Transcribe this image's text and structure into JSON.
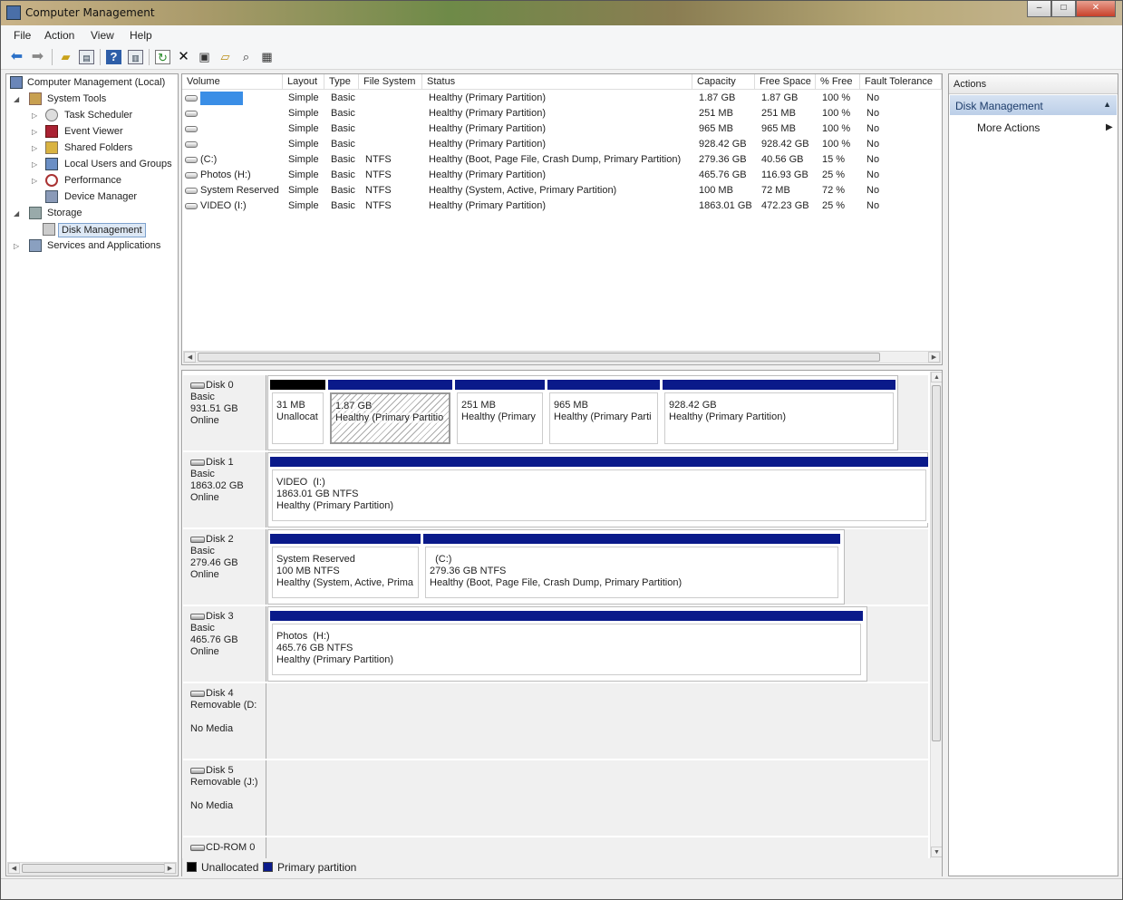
{
  "window": {
    "title": "Computer Management",
    "minimize": "–",
    "maximize": "□",
    "close": "✕"
  },
  "menu": [
    "File",
    "Action",
    "View",
    "Help"
  ],
  "toolbar": [
    "back-icon",
    "forward-icon",
    "up-folder-icon",
    "show-hide-tree-icon",
    "help-icon",
    "properties-icon",
    "refresh-icon",
    "delete-icon",
    "export-icon",
    "open-icon",
    "search-icon",
    "settings-icon"
  ],
  "tree": {
    "root": "Computer Management (Local)",
    "system_tools": "System Tools",
    "task_scheduler": "Task Scheduler",
    "event_viewer": "Event Viewer",
    "shared_folders": "Shared Folders",
    "local_users": "Local Users and Groups",
    "performance": "Performance",
    "device_manager": "Device Manager",
    "storage": "Storage",
    "disk_management": "Disk Management",
    "services": "Services and Applications"
  },
  "volumes": {
    "headers": [
      "Volume",
      "Layout",
      "Type",
      "File System",
      "Status",
      "Capacity",
      "Free Space",
      "% Free",
      "Fault Tolerance"
    ],
    "rows": [
      {
        "volume": "",
        "layout": "Simple",
        "type": "Basic",
        "fs": "",
        "status": "Healthy (Primary Partition)",
        "capacity": "1.87 GB",
        "free": "1.87 GB",
        "pct": "100 %",
        "fault": "No"
      },
      {
        "volume": "",
        "layout": "Simple",
        "type": "Basic",
        "fs": "",
        "status": "Healthy (Primary Partition)",
        "capacity": "251 MB",
        "free": "251 MB",
        "pct": "100 %",
        "fault": "No"
      },
      {
        "volume": "",
        "layout": "Simple",
        "type": "Basic",
        "fs": "",
        "status": "Healthy (Primary Partition)",
        "capacity": "965 MB",
        "free": "965 MB",
        "pct": "100 %",
        "fault": "No"
      },
      {
        "volume": "",
        "layout": "Simple",
        "type": "Basic",
        "fs": "",
        "status": "Healthy (Primary Partition)",
        "capacity": "928.42 GB",
        "free": "928.42 GB",
        "pct": "100 %",
        "fault": "No"
      },
      {
        "volume": "(C:)",
        "layout": "Simple",
        "type": "Basic",
        "fs": "NTFS",
        "status": "Healthy (Boot, Page File, Crash Dump, Primary Partition)",
        "capacity": "279.36 GB",
        "free": "40.56 GB",
        "pct": "15 %",
        "fault": "No"
      },
      {
        "volume": "Photos (H:)",
        "layout": "Simple",
        "type": "Basic",
        "fs": "NTFS",
        "status": "Healthy (Primary Partition)",
        "capacity": "465.76 GB",
        "free": "116.93 GB",
        "pct": "25 %",
        "fault": "No"
      },
      {
        "volume": "System Reserved",
        "layout": "Simple",
        "type": "Basic",
        "fs": "NTFS",
        "status": "Healthy (System, Active, Primary Partition)",
        "capacity": "100 MB",
        "free": "72 MB",
        "pct": "72 %",
        "fault": "No"
      },
      {
        "volume": "VIDEO (I:)",
        "layout": "Simple",
        "type": "Basic",
        "fs": "NTFS",
        "status": "Healthy (Primary Partition)",
        "capacity": "1863.01 GB",
        "free": "472.23 GB",
        "pct": "25 %",
        "fault": "No"
      }
    ]
  },
  "disks": [
    {
      "name": "Disk 0",
      "type": "Basic",
      "size": "931.51 GB",
      "state": "Online",
      "parts": [
        {
          "l1": "31 MB",
          "l2": "Unallocat",
          "kind": "unalloc"
        },
        {
          "l1": "1.87 GB",
          "l2": "Healthy (Primary Partitio",
          "kind": "selected"
        },
        {
          "l1": "251 MB",
          "l2": "Healthy (Primary",
          "kind": "primary"
        },
        {
          "l1": "965 MB",
          "l2": "Healthy (Primary Parti",
          "kind": "primary"
        },
        {
          "l1": "928.42 GB",
          "l2": "Healthy (Primary Partition)",
          "kind": "primary"
        }
      ]
    },
    {
      "name": "Disk 1",
      "type": "Basic",
      "size": "1863.02 GB",
      "state": "Online",
      "parts": [
        {
          "l0": "VIDEO  (I:)",
          "l1": "1863.01 GB NTFS",
          "l2": "Healthy (Primary Partition)",
          "kind": "primary"
        }
      ]
    },
    {
      "name": "Disk 2",
      "type": "Basic",
      "size": "279.46 GB",
      "state": "Online",
      "parts": [
        {
          "l0": "System Reserved",
          "l1": "100 MB NTFS",
          "l2": "Healthy (System, Active, Prima",
          "kind": "primary"
        },
        {
          "l0": "  (C:)",
          "l1": "279.36 GB NTFS",
          "l2": "Healthy (Boot, Page File, Crash Dump, Primary Partition)",
          "kind": "primary"
        }
      ]
    },
    {
      "name": "Disk 3",
      "type": "Basic",
      "size": "465.76 GB",
      "state": "Online",
      "parts": [
        {
          "l0": "Photos  (H:)",
          "l1": "465.76 GB NTFS",
          "l2": "Healthy (Primary Partition)",
          "kind": "primary"
        }
      ]
    },
    {
      "name": "Disk 4",
      "type": "Removable (D:",
      "size": "",
      "state": "No Media",
      "parts": []
    },
    {
      "name": "Disk 5",
      "type": "Removable (J:)",
      "size": "",
      "state": "No Media",
      "parts": []
    },
    {
      "name": "CD-ROM 0",
      "type": "",
      "size": "",
      "state": "",
      "parts": []
    }
  ],
  "legend": {
    "unallocated": "Unallocated",
    "primary": "Primary partition"
  },
  "actions": {
    "header": "Actions",
    "section": "Disk Management",
    "more": "More Actions"
  },
  "colors": {
    "primary": "#0a1a8a",
    "unallocated": "#000000",
    "selection": "#3a8ee6"
  }
}
